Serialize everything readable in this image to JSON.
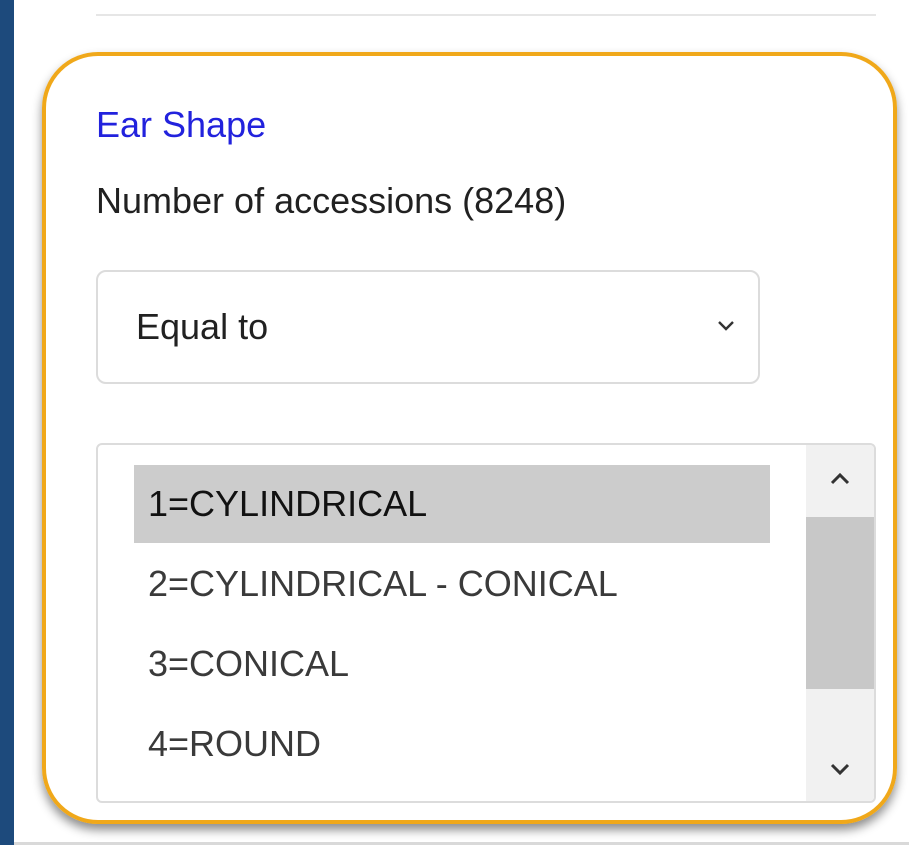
{
  "facet": {
    "title": "Ear Shape",
    "count_label": "Number of accessions (8248)"
  },
  "operator_select": {
    "selected": "Equal to"
  },
  "value_list": {
    "options": [
      {
        "label": "1=CYLINDRICAL",
        "selected": true
      },
      {
        "label": "2=CYLINDRICAL - CONICAL",
        "selected": false
      },
      {
        "label": "3=CONICAL",
        "selected": false
      },
      {
        "label": "4=ROUND",
        "selected": false
      }
    ]
  },
  "colors": {
    "highlight": "#f0a81a",
    "link": "#2222dd",
    "background": "#1d4a7c",
    "selected_row": "#cccccc"
  },
  "icons": [
    "chevron-down-icon",
    "chevron-up-icon"
  ]
}
